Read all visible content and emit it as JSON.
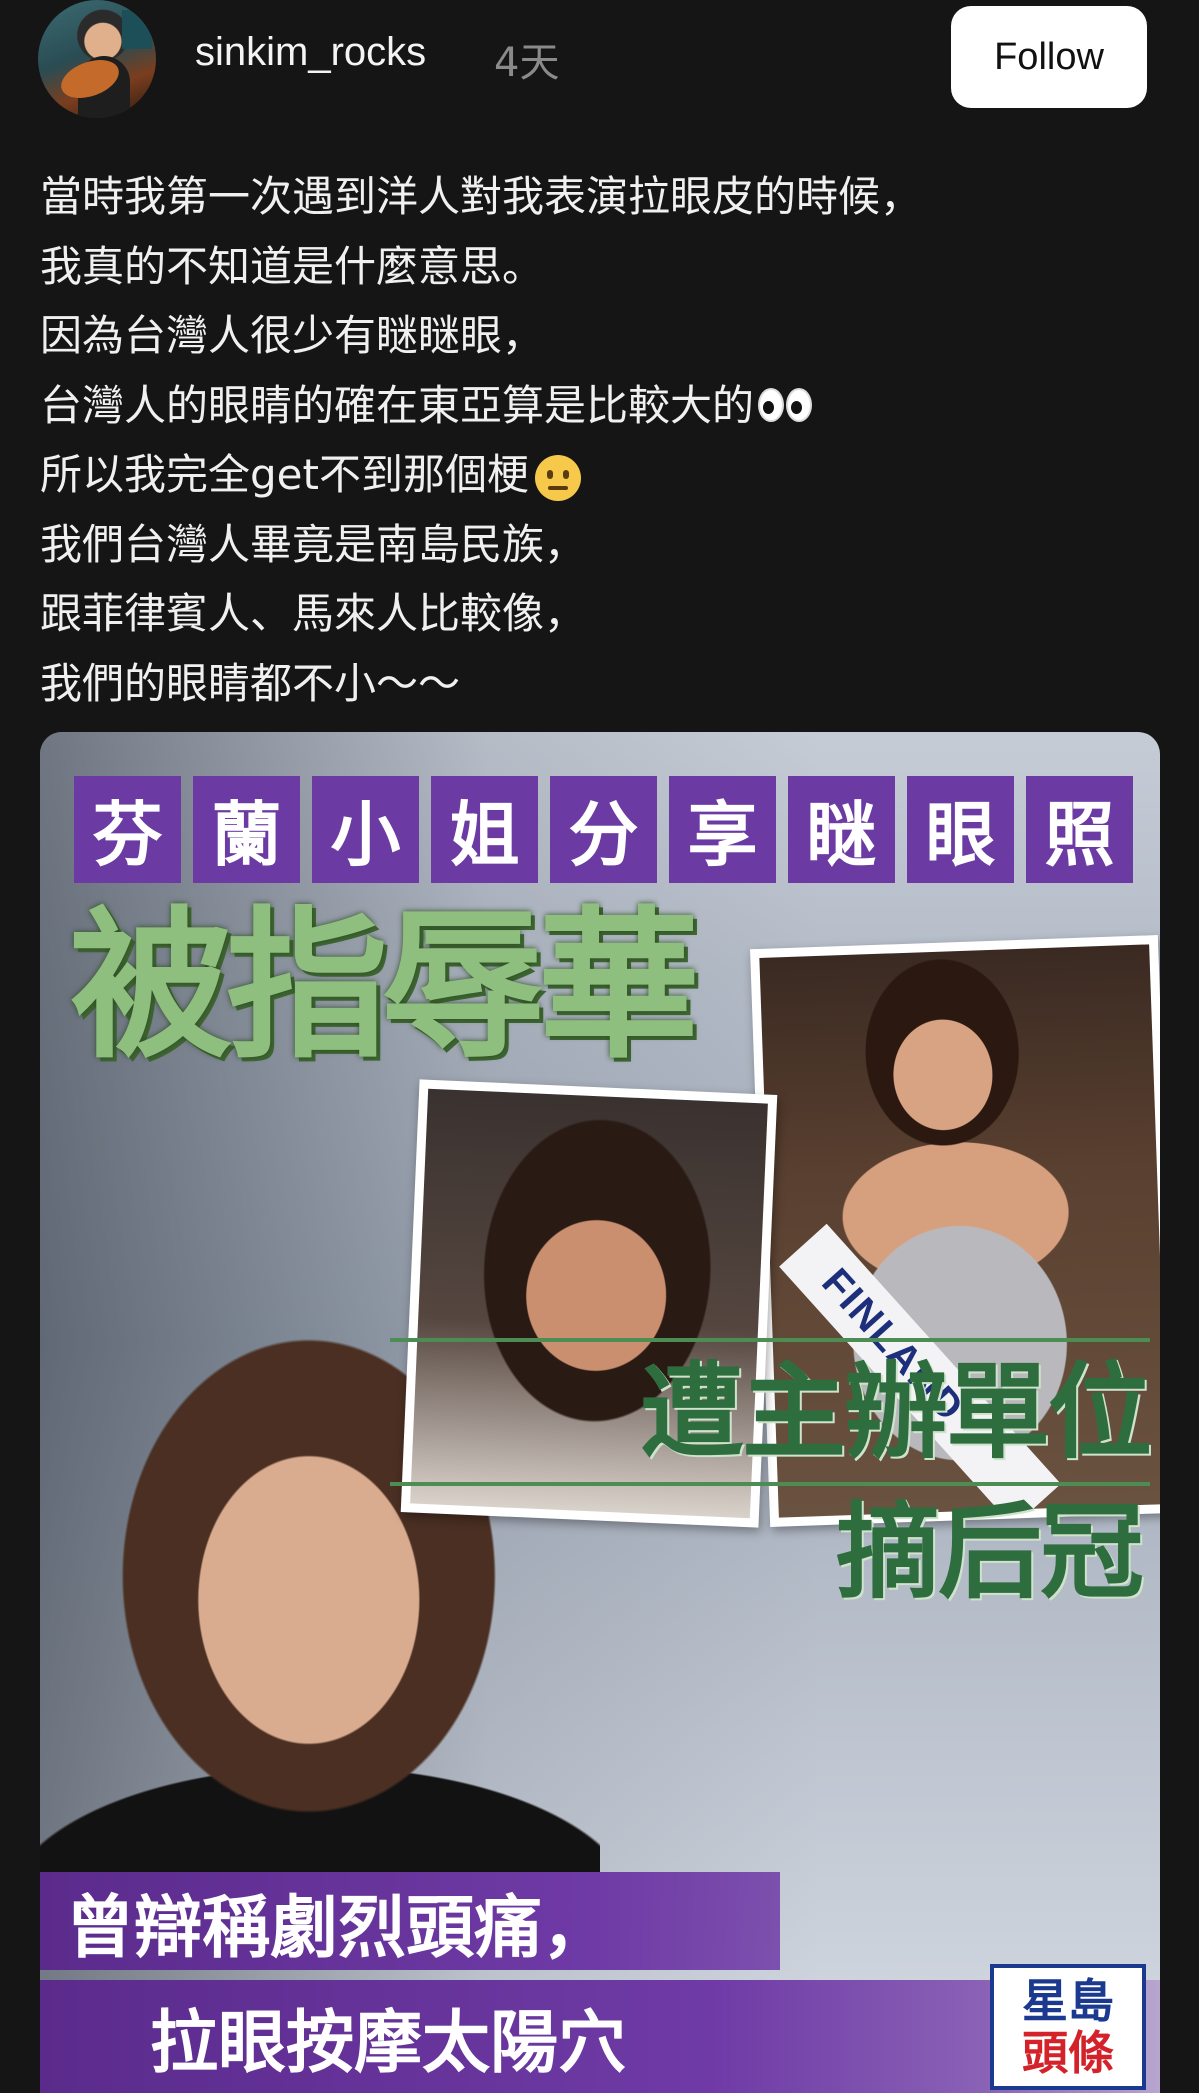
{
  "post": {
    "username": "sinkim_rocks",
    "time": "4天",
    "follow_label": "Follow",
    "caption_lines": [
      "當時我第一次遇到洋人對我表演拉眼皮的時候，",
      "我真的不知道是什麼意思。",
      "因為台灣人很少有瞇瞇眼，",
      "台灣人的眼睛的確在東亞算是比較大的",
      "所以我完全get不到那個梗",
      "我們台灣人畢竟是南島民族，",
      "跟菲律賓人、馬來人比較像，",
      "我們的眼睛都不小～～"
    ]
  },
  "news": {
    "title_tiles": [
      "芬",
      "蘭",
      "小",
      "姐",
      "分",
      "享",
      "瞇",
      "眼",
      "照"
    ],
    "headline": "被指辱華",
    "green_line1": "遭主辦單位",
    "green_line2": "摘后冠",
    "sash_text": "FINLAND",
    "purple_line1": "曾辯稱劇烈頭痛，",
    "purple_line2": "拉眼按摩太陽穴",
    "logo_line1": "星島",
    "logo_line2": "頭條"
  }
}
